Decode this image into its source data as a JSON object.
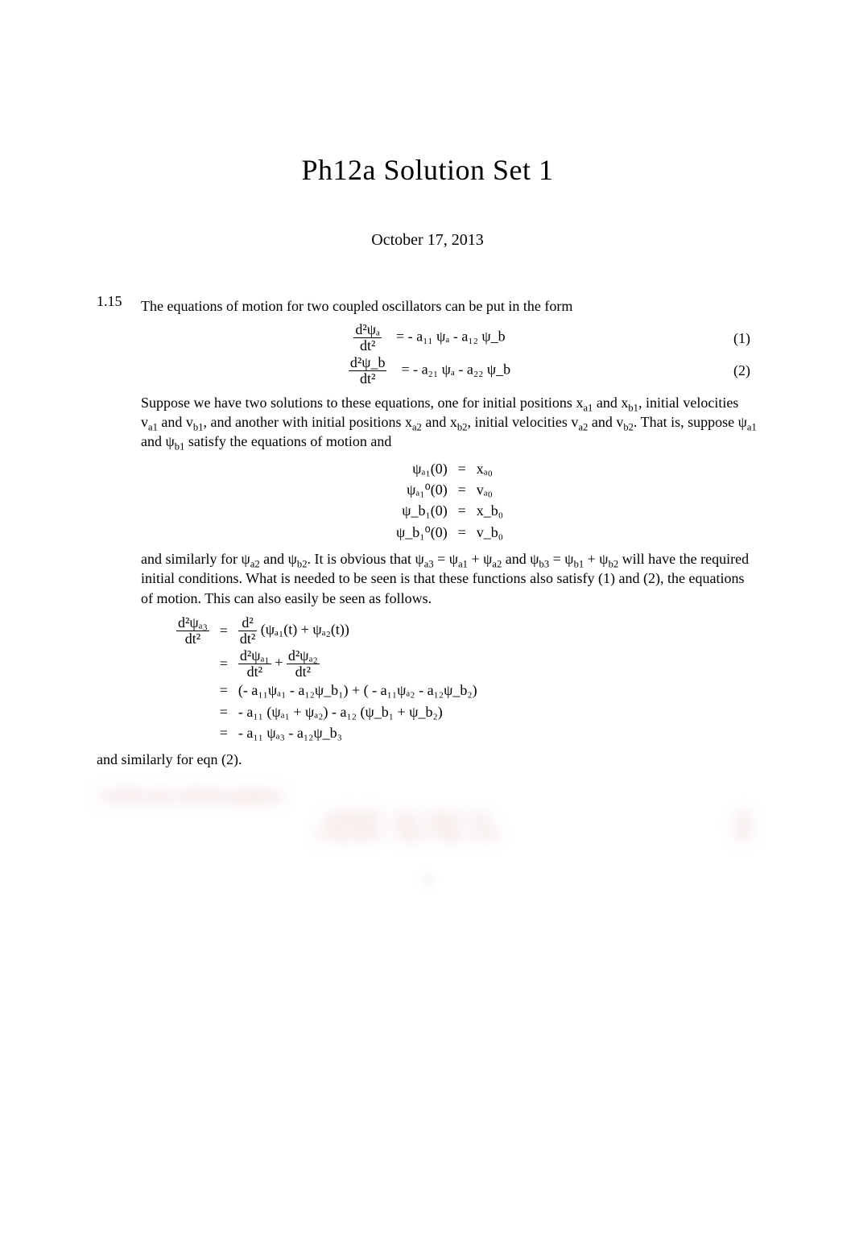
{
  "title": "Ph12a Solution Set 1",
  "date": "October 17, 2013",
  "item115": {
    "number": "1.15",
    "intro": "The equations of motion for two coupled oscillators can be put in the form",
    "eq1_lhs_num": "d²ψₐ",
    "eq1_lhs_den": "dt²",
    "eq1_rhs": "=  - a₁₁ ψₐ -  a₁₂ ψ_b",
    "eq1_tag": "(1)",
    "eq2_lhs_num": "d²ψ_b",
    "eq2_lhs_den": "dt²",
    "eq2_rhs": "=  - a₂₁ ψₐ -  a₂₂ ψ_b",
    "eq2_tag": "(2)",
    "para1a": "Suppose we have two solutions to these equations, one for initial positions x",
    "para1b": " and x",
    "para1c": ", initial velocities  v",
    "para1d": " and v",
    "para1e": ", and another with initial positions x",
    "para1f": " and x",
    "para1g": ", initial velocities  v",
    "para1h": " and v",
    "para1i": ". That is, suppose  ψ",
    "para1j": " and ψ",
    "para1k": " satisfy the equations of motion and",
    "sub_a1": "a1",
    "sub_b1": "b1",
    "sub_a2": "a2",
    "sub_b2": "b2",
    "ic1_l": "ψₐ₁(0)",
    "ic1_r": "xₐ₀",
    "ic2_l": "ψₐ₁⁰(0)",
    "ic2_r": "vₐ₀",
    "ic3_l": "ψ_b₁(0)",
    "ic3_r": "x_b₀",
    "ic4_l": "ψ_b₁⁰(0)",
    "ic4_r": "v_b₀",
    "para2a": "and similarly for  ψ",
    "para2b": " and ψ",
    "para2c": ".  It is obvious that  ψ",
    "para2d": " = ψ",
    "para2e": " + ψ",
    "para2f": " and ψ",
    "para2g": " = ψ",
    "para2h": " + ψ",
    "para2i": " will have the required initial conditions. What is needed to be seen is that these functions also satisfy (1) and (2), the equations of motion. This can also easily be seen as follows.",
    "sub_a3": "a3",
    "sub_b3": "b3",
    "deriv_l_num": "d²ψₐ₃",
    "deriv_l_den": "dt²",
    "deriv_r1_num": "d²",
    "deriv_r1_den": "dt²",
    "deriv_r1_tail": " (ψₐ₁(t) + ψₐ₂(t))",
    "deriv_r2a_num": "d²ψₐ₁",
    "deriv_r2a_den": "dt²",
    "deriv_r2_plus": " + ",
    "deriv_r2b_num": "d²ψₐ₂",
    "deriv_r2b_den": "dt²",
    "deriv_r3": "(- a₁₁ψₐ₁ - a₁₂ψ_b₁) + ( - a₁₁ψₐ₂ -  a₁₂ψ_b₂)",
    "deriv_r4": " - a₁₁ (ψₐ₁ + ψₐ₂) -  a₁₂ (ψ_b₁ + ψ_b₂)",
    "deriv_r5": " - a₁₁ ψₐ₃ -  a₁₂ψ_b₃",
    "closing": "and similarly for eqn (2)."
  },
  "blurred_section": {
    "lead": "1.18   We start with the equations",
    "eq3_center": "m d²ψₐ/dt²   =   - kψₐ + k(ψ_b - ψₐ)",
    "eq3_tag": "(3)",
    "eq4_center": "m d²ψ_b/dt²   =   - kψ_b + k(ψₐ - ψ_b)",
    "eq4_tag": "(4)",
    "page_no": "1"
  }
}
